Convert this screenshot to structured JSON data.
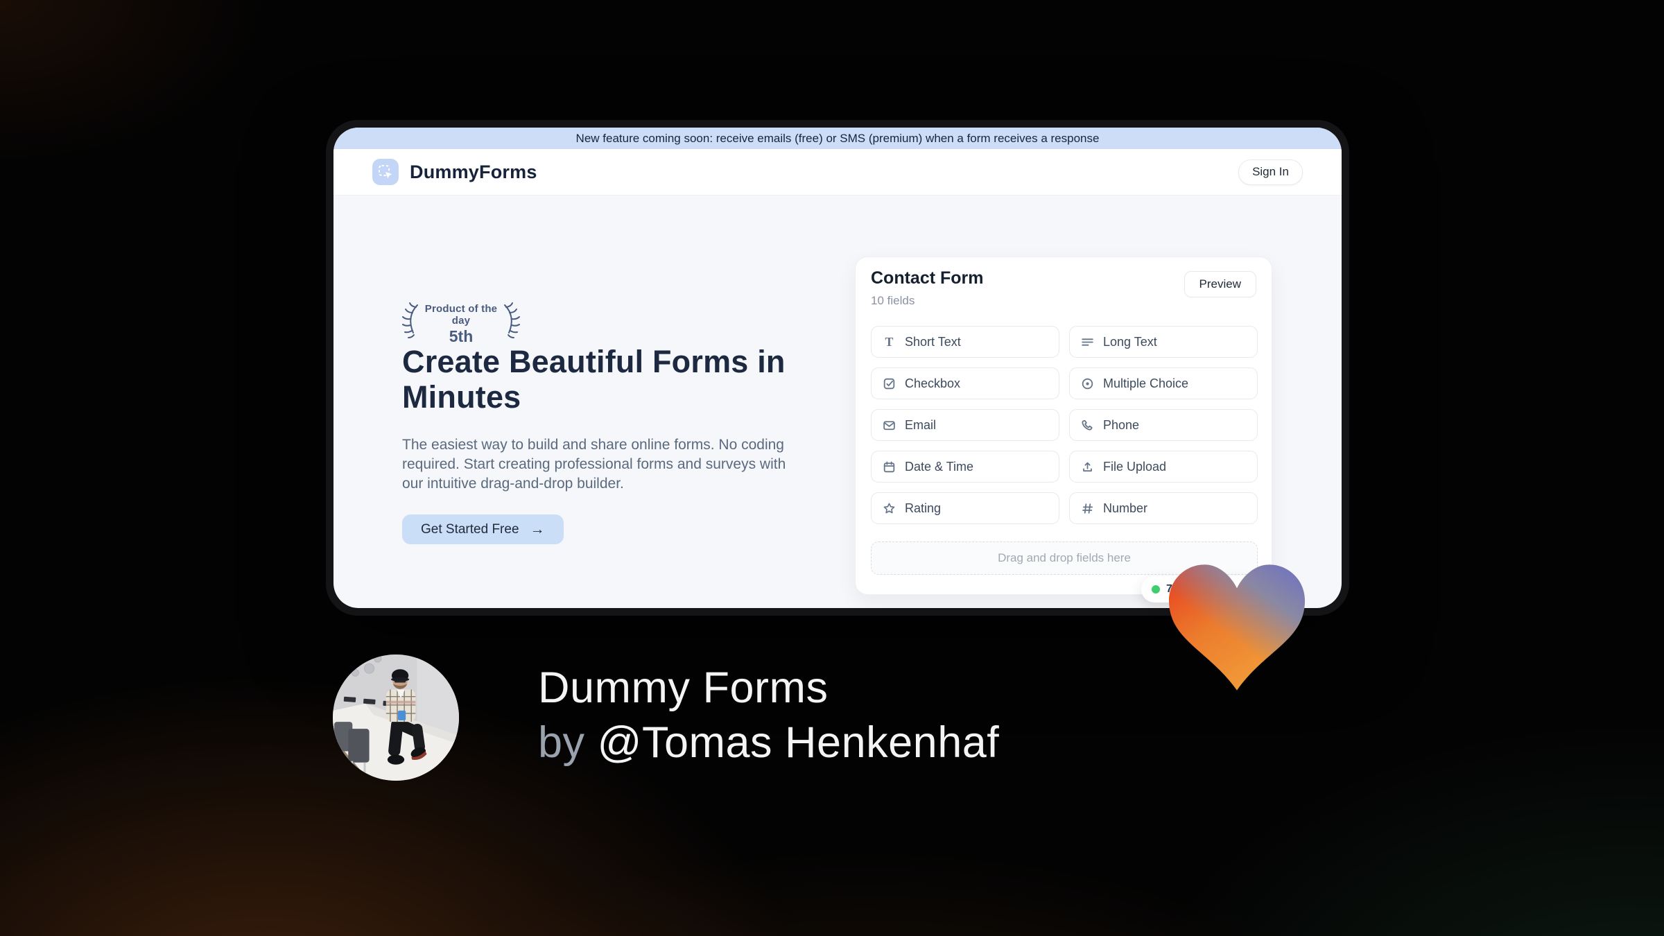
{
  "banner": {
    "text": "New feature coming soon: receive emails (free) or SMS (premium) when a form receives a response",
    "bg_color": "#cdddf8"
  },
  "header": {
    "brand": "DummyForms",
    "logo_icon": "dashed-select-cursor-icon",
    "sign_in_label": "Sign In"
  },
  "hero": {
    "award": {
      "line1": "Product of the day",
      "line2": "5th"
    },
    "title": "Create Beautiful Forms in Minutes",
    "description": "The easiest way to build and share online forms. No coding required. Start creating professional forms and surveys with our intuitive drag-and-drop builder.",
    "cta_label": "Get Started Free",
    "cta_arrow": "→",
    "cta_bg_color": "#cbdef7"
  },
  "form_card": {
    "title": "Contact Form",
    "subtitle": "10 fields",
    "preview_label": "Preview",
    "fields": [
      {
        "label": "Short Text",
        "icon": "short-text-icon"
      },
      {
        "label": "Long Text",
        "icon": "long-text-icon"
      },
      {
        "label": "Checkbox",
        "icon": "checkbox-icon"
      },
      {
        "label": "Multiple Choice",
        "icon": "radio-icon"
      },
      {
        "label": "Email",
        "icon": "envelope-icon"
      },
      {
        "label": "Phone",
        "icon": "phone-icon"
      },
      {
        "label": "Date & Time",
        "icon": "calendar-icon"
      },
      {
        "label": "File Upload",
        "icon": "upload-icon"
      },
      {
        "label": "Rating",
        "icon": "star-icon"
      },
      {
        "label": "Number",
        "icon": "hash-icon"
      }
    ],
    "dropzone_text": "Drag and drop fields here",
    "count_badge": {
      "visible_text": "77",
      "dot_color": "#3fce6e"
    }
  },
  "heart": {
    "colors": {
      "red": "#e73a1e",
      "orange": "#f2a03a",
      "blue": "#6a6fc6",
      "slate": "#8289ad"
    }
  },
  "footer": {
    "product_name": "Dummy Forms",
    "by_prefix": "by ",
    "author_handle": "@Tomas Henkenhaf"
  }
}
